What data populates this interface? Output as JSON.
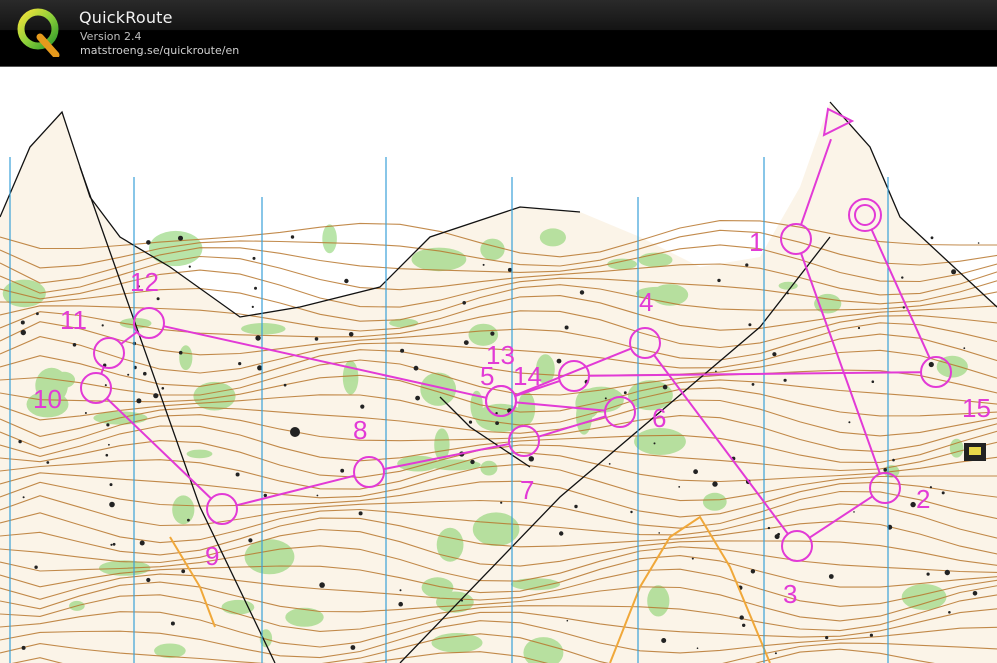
{
  "app": {
    "title": "QuickRoute",
    "version": "Version 2.4",
    "url": "matstroeng.se/quickroute/en",
    "logo_letter": "Q"
  },
  "colors": {
    "course": "#e23ad6",
    "contour": "#b8772e",
    "vegetation": "#4cb83a",
    "rock": "#222222",
    "north_line": "#3aa0d8",
    "titlebar": "#111111"
  },
  "map": {
    "controls": [
      {
        "id": "1",
        "label": "1"
      },
      {
        "id": "2",
        "label": "2"
      },
      {
        "id": "3",
        "label": "3"
      },
      {
        "id": "4",
        "label": "4"
      },
      {
        "id": "5",
        "label": "5"
      },
      {
        "id": "6",
        "label": "6"
      },
      {
        "id": "7",
        "label": "7"
      },
      {
        "id": "8",
        "label": "8"
      },
      {
        "id": "9",
        "label": "9"
      },
      {
        "id": "10",
        "label": "10"
      },
      {
        "id": "11",
        "label": "11"
      },
      {
        "id": "12",
        "label": "12"
      },
      {
        "id": "13",
        "label": "13"
      },
      {
        "id": "14",
        "label": "14"
      },
      {
        "id": "15",
        "label": "15"
      }
    ],
    "course_order": [
      "start",
      "1",
      "2",
      "3",
      "4",
      "5",
      "6",
      "7",
      "8",
      "9",
      "10",
      "11",
      "12",
      "13",
      "14",
      "15",
      "finish"
    ]
  }
}
